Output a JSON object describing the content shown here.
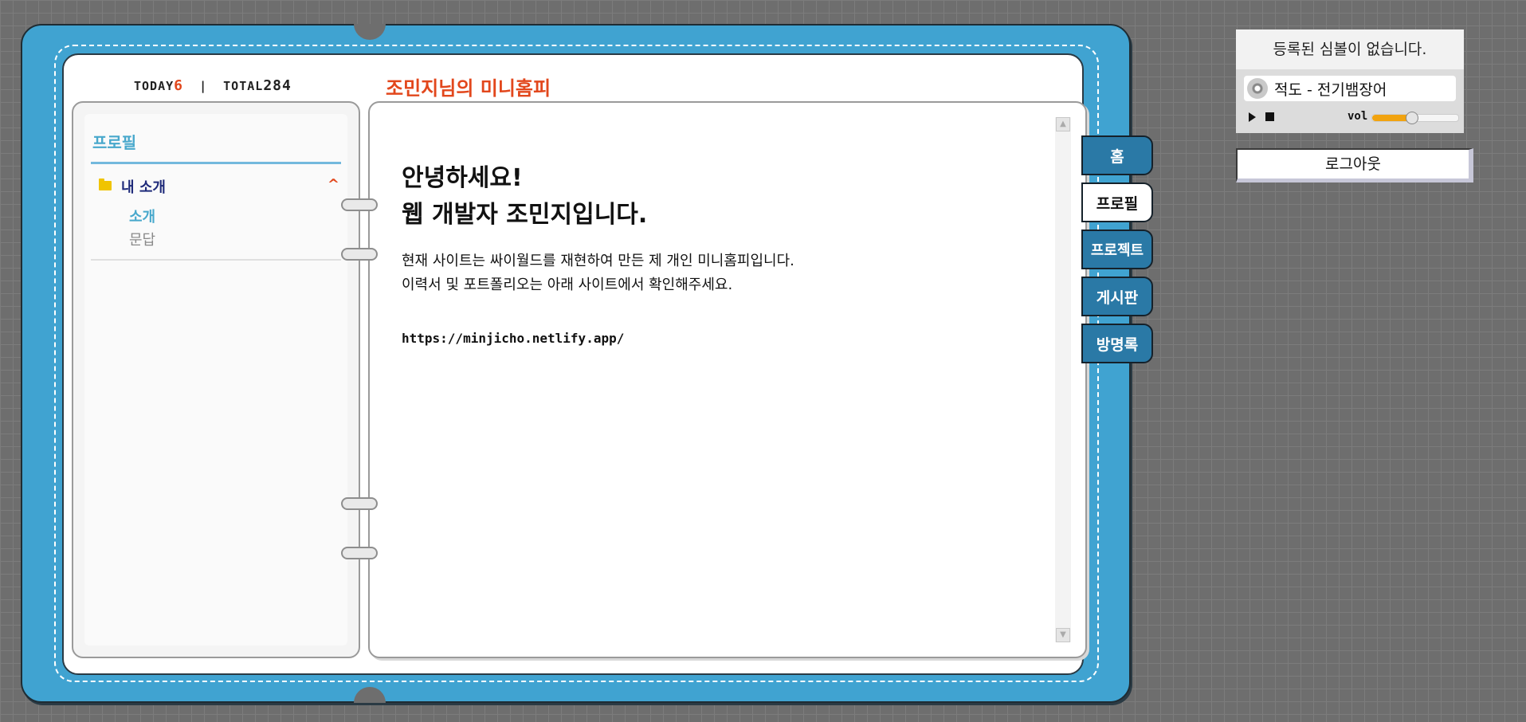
{
  "counter": {
    "today_label": "TODAY",
    "today_value": "6",
    "separator": "|",
    "total_label": "TOTAL",
    "total_value": "284"
  },
  "sidebar": {
    "title": "프로필",
    "folder_label": "내 소개",
    "items": [
      {
        "label": "소개",
        "active": true
      },
      {
        "label": "문답",
        "active": false
      }
    ]
  },
  "main": {
    "site_title": "조민지님의 미니홈피",
    "greeting_line1": "안녕하세요!",
    "greeting_line2": "웹 개발자 조민지입니다.",
    "desc_line1": "현재 사이트는 싸이월드를 재현하여 만든 제 개인 미니홈피입니다.",
    "desc_line2": "이력서 및 포트폴리오는 아래 사이트에서 확인해주세요.",
    "url": "https://minjicho.netlify.app/"
  },
  "tabs": [
    {
      "label": "홈",
      "active": false
    },
    {
      "label": "프로필",
      "active": true
    },
    {
      "label": "프로젝트",
      "active": false
    },
    {
      "label": "게시판",
      "active": false
    },
    {
      "label": "방명록",
      "active": false
    }
  ],
  "widgets": {
    "symbol_text": "등록된 심볼이 없습니다.",
    "song_title": "적도 - 전기뱀장어",
    "vol_label": "vol",
    "volume_fraction": 0.45,
    "logout_label": "로그아웃"
  },
  "colors": {
    "cover": "#40a3d1",
    "tab": "#2a79a6",
    "accent": "#e2471c",
    "sidebar_accent": "#48a8cc",
    "volume": "#f1a30f"
  }
}
